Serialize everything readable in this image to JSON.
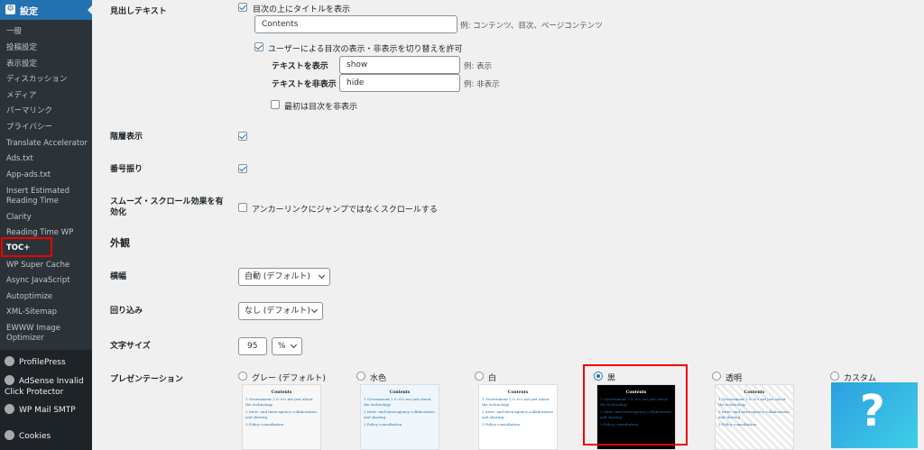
{
  "sidebar": {
    "header": "設定",
    "items": [
      {
        "label": "一般"
      },
      {
        "label": "投稿設定"
      },
      {
        "label": "表示設定"
      },
      {
        "label": "ディスカッション"
      },
      {
        "label": "メディア"
      },
      {
        "label": "パーマリンク"
      },
      {
        "label": "プライバシー"
      },
      {
        "label": "Translate Accelerator"
      },
      {
        "label": "Ads.txt"
      },
      {
        "label": "App-ads.txt"
      },
      {
        "label": "Insert Estimated Reading Time"
      },
      {
        "label": "Clarity"
      },
      {
        "label": "Reading Time WP"
      },
      {
        "label": "TOC+"
      },
      {
        "label": "WP Super Cache"
      },
      {
        "label": "Async JavaScript"
      },
      {
        "label": "Autoptimize"
      },
      {
        "label": "XML-Sitemap"
      },
      {
        "label": "EWWW Image Optimizer"
      }
    ],
    "plugins": [
      {
        "label": "ProfilePress"
      },
      {
        "label": "AdSense Invalid Click Protector"
      },
      {
        "label": "WP Mail SMTP"
      },
      {
        "label": "Cookies"
      }
    ]
  },
  "heading_text": {
    "label": "見出しテキスト",
    "show_title_label": "目次の上にタイトルを表示",
    "title_value": "Contents",
    "title_example": "例: コンテンツ、目次、ページコンテンツ",
    "allow_toggle_label": "ユーザーによる目次の表示・非表示を切り替えを許可",
    "show_text_label": "テキストを表示",
    "show_text_value": "show",
    "show_text_example": "例: 表示",
    "hide_text_label": "テキストを非表示",
    "hide_text_value": "hide",
    "hide_text_example": "例: 非表示",
    "hide_initially_label": "最初は目次を非表示"
  },
  "hierarchy": {
    "label": "階層表示"
  },
  "numbering": {
    "label": "番号振り"
  },
  "smooth_scroll": {
    "label": "スムーズ・スクロール効果を有効化",
    "option": "アンカーリンクにジャンプではなくスクロールする"
  },
  "appearance": {
    "heading": "外観"
  },
  "width": {
    "label": "横幅",
    "value": "自動 (デフォルト)"
  },
  "wrapping": {
    "label": "回り込み",
    "value": "なし (デフォルト)"
  },
  "font_size": {
    "label": "文字サイズ",
    "value": "95",
    "unit": "%"
  },
  "presentation": {
    "label": "プレゼンテーション",
    "options": [
      {
        "label": "グレー (デフォルト)"
      },
      {
        "label": "水色"
      },
      {
        "label": "白"
      },
      {
        "label": "黒"
      },
      {
        "label": "透明"
      },
      {
        "label": "カスタム"
      }
    ],
    "preview": {
      "heading": "Contents",
      "line1": "1 Government 2.0: it's not just about the technology",
      "line2": "2 Inter- and intra-agency collaboration and sharing",
      "line3": "3 Policy consultation",
      "custom_mark": "?"
    }
  },
  "colors": {
    "accent": "#2271b1",
    "highlight": "#e00000",
    "sidebar": "#1d2327"
  }
}
